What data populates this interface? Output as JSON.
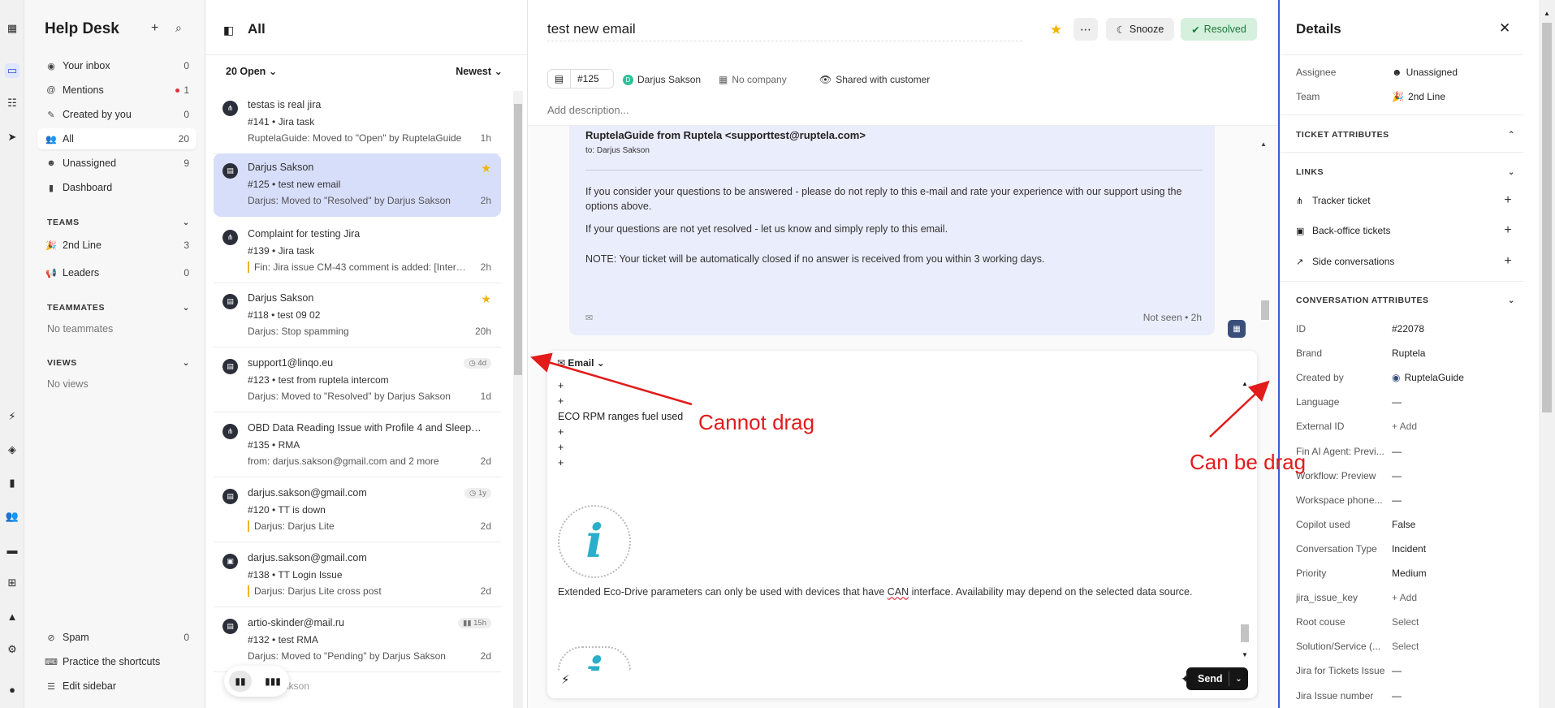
{
  "rail": {
    "icons": [
      "intercom-logo-icon",
      "inbox-icon",
      "contacts-icon",
      "send-icon",
      "bolt-icon",
      "layers-icon",
      "reports-icon",
      "people-icon",
      "book-icon",
      "apps-icon",
      "academy-icon",
      "settings-icon",
      "user-status-icon"
    ]
  },
  "sidebar": {
    "title": "Help Desk",
    "items": [
      {
        "label": "Your inbox",
        "count": "0",
        "icon": "person-icon"
      },
      {
        "label": "Mentions",
        "count": "1",
        "icon": "at-icon"
      },
      {
        "label": "Created by you",
        "count": "0",
        "icon": "pen-icon"
      },
      {
        "label": "All",
        "count": "20",
        "icon": "people-icon"
      },
      {
        "label": "Unassigned",
        "count": "9",
        "icon": "unassigned-icon"
      },
      {
        "label": "Dashboard",
        "count": "",
        "icon": "chart-icon"
      }
    ],
    "teams_heading": "TEAMS",
    "teams": [
      {
        "label": "2nd Line",
        "count": "3"
      },
      {
        "label": "Leaders",
        "count": "0"
      }
    ],
    "teammates_heading": "TEAMMATES",
    "teammates_empty": "No teammates",
    "views_heading": "VIEWS",
    "views_empty": "No views",
    "bottom": [
      {
        "label": "Spam",
        "count": "0"
      },
      {
        "label": "Practice the shortcuts",
        "count": ""
      },
      {
        "label": "Edit sidebar",
        "count": ""
      }
    ]
  },
  "list": {
    "title": "All",
    "filter": "20 Open",
    "sort": "Newest",
    "tickets": [
      {
        "title": "testas is real jira",
        "sub": "#141 • Jira task",
        "line": "RuptelaGuide: Moved to \"Open\" by RuptelaGuide",
        "age": "1h",
        "star": false,
        "badge": ""
      },
      {
        "title": "Darjus Sakson",
        "sub": "#125 • test new email",
        "line": "Darjus: Moved to \"Resolved\" by Darjus Sakson",
        "age": "2h",
        "star": true,
        "badge": ""
      },
      {
        "title": "Complaint for testing Jira",
        "sub": "#139 • Jira task",
        "line": "Fin: Jira issue CM-43 comment is added: [Interco...",
        "age": "2h",
        "star": false,
        "badge": ""
      },
      {
        "title": "Darjus Sakson",
        "sub": "#118 • test 09 02",
        "line": "Darjus: Stop spamming",
        "age": "20h",
        "star": true,
        "badge": ""
      },
      {
        "title": "support1@linqo.eu",
        "sub": "#123 • test from ruptela intercom",
        "line": "Darjus: Moved to \"Resolved\" by Darjus Sakson",
        "age": "1d",
        "star": false,
        "badge": "4d"
      },
      {
        "title": "OBD Data Reading Issue with Profile 4 and Sleep M...",
        "sub": "#135 • RMA",
        "line": "from: darjus.sakson@gmail.com and 2 more",
        "age": "2d",
        "star": false,
        "badge": ""
      },
      {
        "title": "darjus.sakson@gmail.com",
        "sub": "#120 • TT is down",
        "line": "Darjus: Darjus Lite",
        "age": "2d",
        "star": false,
        "badge": "1y"
      },
      {
        "title": "darjus.sakson@gmail.com",
        "sub": "#138 • TT Login Issue",
        "line": "Darjus: Darjus Lite cross post",
        "age": "2d",
        "star": false,
        "badge": ""
      },
      {
        "title": "artio-skinder@mail.ru",
        "sub": "#132 • test RMA",
        "line": "Darjus: Moved to \"Pending\" by Darjus Sakson",
        "age": "2d",
        "star": false,
        "badge": "15h"
      }
    ],
    "partial_next": "Sakson"
  },
  "conversation": {
    "title": "test new email",
    "snooze_label": "Snooze",
    "resolved_label": "Resolved",
    "ticket_id": "#125",
    "customer": "Darjus Sakson",
    "customer_initial": "D",
    "company": "No company",
    "visibility": "Shared with customer",
    "add_description": "Add description...",
    "message": {
      "from": "RuptelaGuide from Ruptela <supporttest@ruptela.com>",
      "to": "to: Darjus Sakson",
      "p1": "If you consider your questions to be answered - please do not reply to this e-mail and rate your experience with our support using the options above.",
      "p2": "If your questions are not yet resolved - let us know and simply reply to this email.",
      "p3": "NOTE: Your ticket will be automatically closed if no answer is received from you within 3 working days.",
      "status": "Not seen • 2h"
    },
    "composer": {
      "channel": "Email",
      "lines": [
        "+",
        "+",
        "ECO RPM ranges fuel used",
        "+",
        "+",
        "+"
      ],
      "caption_before": "Extended Eco-Drive parameters can only be used with devices that have ",
      "caption_underlined": "CAN",
      "caption_after": " interface. Availability may depend on the selected data source.",
      "send_label": "Send"
    }
  },
  "details": {
    "title": "Details",
    "assignee_label": "Assignee",
    "assignee_value": "Unassigned",
    "team_label": "Team",
    "team_value": "2nd Line",
    "ticket_attributes": "TICKET ATTRIBUTES",
    "links_heading": "LINKS",
    "links": [
      "Tracker ticket",
      "Back-office tickets",
      "Side conversations"
    ],
    "conversation_attributes": "CONVERSATION ATTRIBUTES",
    "attributes": [
      {
        "k": "ID",
        "v": "#22078",
        "muted": false
      },
      {
        "k": "Brand",
        "v": "Ruptela",
        "muted": false
      },
      {
        "k": "Created by",
        "v": "RuptelaGuide",
        "muted": false
      },
      {
        "k": "Language",
        "v": "—",
        "muted": false
      },
      {
        "k": "External ID",
        "v": "+ Add",
        "muted": true
      },
      {
        "k": "Fin AI Agent: Previ...",
        "v": "—",
        "muted": false
      },
      {
        "k": "Workflow: Preview",
        "v": "—",
        "muted": false
      },
      {
        "k": "Workspace phone...",
        "v": "—",
        "muted": false
      },
      {
        "k": "Copilot used",
        "v": "False",
        "muted": false
      },
      {
        "k": "Conversation Type",
        "v": "Incident",
        "muted": false
      },
      {
        "k": "Priority",
        "v": "Medium",
        "muted": false
      },
      {
        "k": "jira_issue_key",
        "v": "+ Add",
        "muted": true
      },
      {
        "k": "Root couse",
        "v": "Select",
        "muted": true
      },
      {
        "k": "Solution/Service (...",
        "v": "Select",
        "muted": true
      },
      {
        "k": "Jira for Tickets Issue",
        "v": "—",
        "muted": false
      },
      {
        "k": "Jira Issue number",
        "v": "—",
        "muted": false
      }
    ]
  },
  "annotations": {
    "left": "Cannot drag",
    "right": "Can be drag",
    "color": "#e21b1b"
  }
}
